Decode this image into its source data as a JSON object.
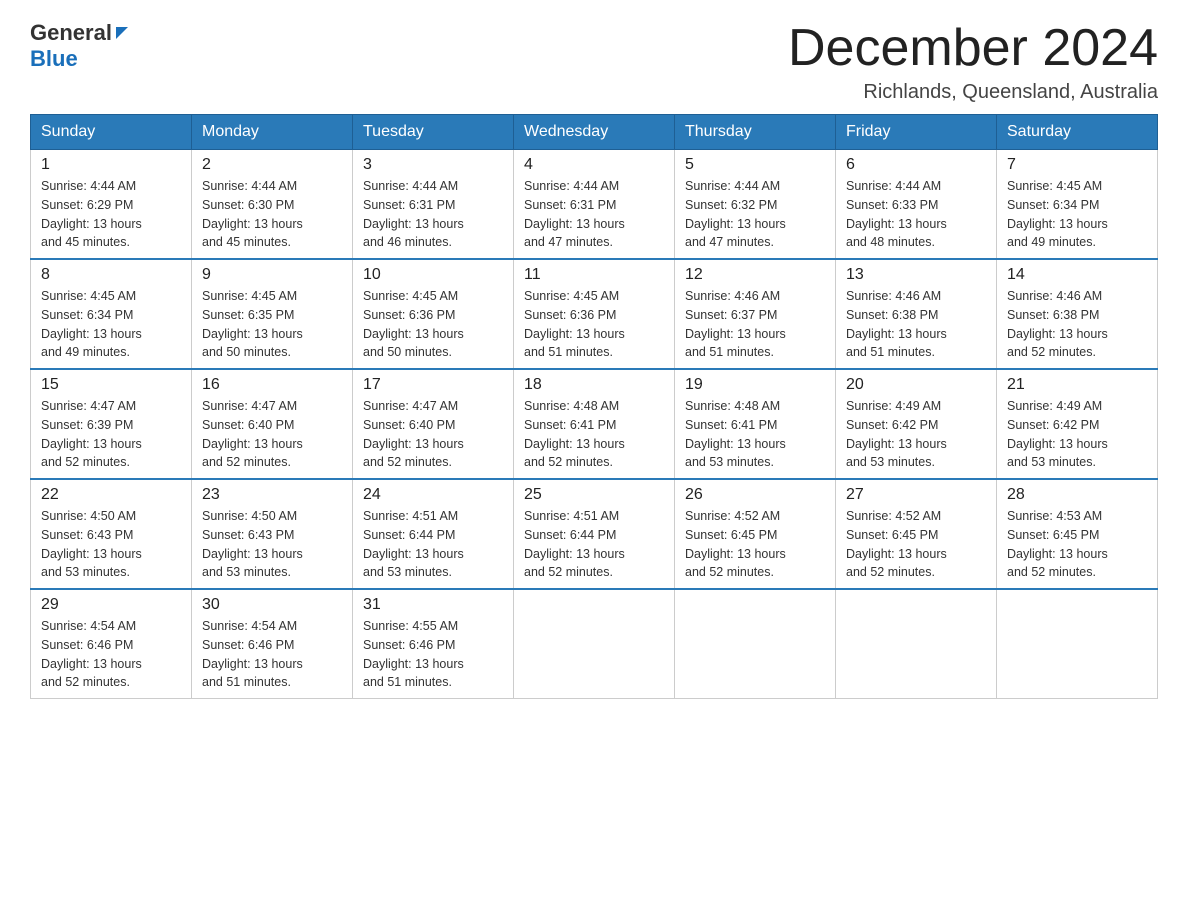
{
  "header": {
    "logo_general": "General",
    "logo_blue": "Blue",
    "month_title": "December 2024",
    "location": "Richlands, Queensland, Australia"
  },
  "weekdays": [
    "Sunday",
    "Monday",
    "Tuesday",
    "Wednesday",
    "Thursday",
    "Friday",
    "Saturday"
  ],
  "weeks": [
    [
      {
        "day": "1",
        "sunrise": "4:44 AM",
        "sunset": "6:29 PM",
        "daylight": "13 hours and 45 minutes."
      },
      {
        "day": "2",
        "sunrise": "4:44 AM",
        "sunset": "6:30 PM",
        "daylight": "13 hours and 45 minutes."
      },
      {
        "day": "3",
        "sunrise": "4:44 AM",
        "sunset": "6:31 PM",
        "daylight": "13 hours and 46 minutes."
      },
      {
        "day": "4",
        "sunrise": "4:44 AM",
        "sunset": "6:31 PM",
        "daylight": "13 hours and 47 minutes."
      },
      {
        "day": "5",
        "sunrise": "4:44 AM",
        "sunset": "6:32 PM",
        "daylight": "13 hours and 47 minutes."
      },
      {
        "day": "6",
        "sunrise": "4:44 AM",
        "sunset": "6:33 PM",
        "daylight": "13 hours and 48 minutes."
      },
      {
        "day": "7",
        "sunrise": "4:45 AM",
        "sunset": "6:34 PM",
        "daylight": "13 hours and 49 minutes."
      }
    ],
    [
      {
        "day": "8",
        "sunrise": "4:45 AM",
        "sunset": "6:34 PM",
        "daylight": "13 hours and 49 minutes."
      },
      {
        "day": "9",
        "sunrise": "4:45 AM",
        "sunset": "6:35 PM",
        "daylight": "13 hours and 50 minutes."
      },
      {
        "day": "10",
        "sunrise": "4:45 AM",
        "sunset": "6:36 PM",
        "daylight": "13 hours and 50 minutes."
      },
      {
        "day": "11",
        "sunrise": "4:45 AM",
        "sunset": "6:36 PM",
        "daylight": "13 hours and 51 minutes."
      },
      {
        "day": "12",
        "sunrise": "4:46 AM",
        "sunset": "6:37 PM",
        "daylight": "13 hours and 51 minutes."
      },
      {
        "day": "13",
        "sunrise": "4:46 AM",
        "sunset": "6:38 PM",
        "daylight": "13 hours and 51 minutes."
      },
      {
        "day": "14",
        "sunrise": "4:46 AM",
        "sunset": "6:38 PM",
        "daylight": "13 hours and 52 minutes."
      }
    ],
    [
      {
        "day": "15",
        "sunrise": "4:47 AM",
        "sunset": "6:39 PM",
        "daylight": "13 hours and 52 minutes."
      },
      {
        "day": "16",
        "sunrise": "4:47 AM",
        "sunset": "6:40 PM",
        "daylight": "13 hours and 52 minutes."
      },
      {
        "day": "17",
        "sunrise": "4:47 AM",
        "sunset": "6:40 PM",
        "daylight": "13 hours and 52 minutes."
      },
      {
        "day": "18",
        "sunrise": "4:48 AM",
        "sunset": "6:41 PM",
        "daylight": "13 hours and 52 minutes."
      },
      {
        "day": "19",
        "sunrise": "4:48 AM",
        "sunset": "6:41 PM",
        "daylight": "13 hours and 53 minutes."
      },
      {
        "day": "20",
        "sunrise": "4:49 AM",
        "sunset": "6:42 PM",
        "daylight": "13 hours and 53 minutes."
      },
      {
        "day": "21",
        "sunrise": "4:49 AM",
        "sunset": "6:42 PM",
        "daylight": "13 hours and 53 minutes."
      }
    ],
    [
      {
        "day": "22",
        "sunrise": "4:50 AM",
        "sunset": "6:43 PM",
        "daylight": "13 hours and 53 minutes."
      },
      {
        "day": "23",
        "sunrise": "4:50 AM",
        "sunset": "6:43 PM",
        "daylight": "13 hours and 53 minutes."
      },
      {
        "day": "24",
        "sunrise": "4:51 AM",
        "sunset": "6:44 PM",
        "daylight": "13 hours and 53 minutes."
      },
      {
        "day": "25",
        "sunrise": "4:51 AM",
        "sunset": "6:44 PM",
        "daylight": "13 hours and 52 minutes."
      },
      {
        "day": "26",
        "sunrise": "4:52 AM",
        "sunset": "6:45 PM",
        "daylight": "13 hours and 52 minutes."
      },
      {
        "day": "27",
        "sunrise": "4:52 AM",
        "sunset": "6:45 PM",
        "daylight": "13 hours and 52 minutes."
      },
      {
        "day": "28",
        "sunrise": "4:53 AM",
        "sunset": "6:45 PM",
        "daylight": "13 hours and 52 minutes."
      }
    ],
    [
      {
        "day": "29",
        "sunrise": "4:54 AM",
        "sunset": "6:46 PM",
        "daylight": "13 hours and 52 minutes."
      },
      {
        "day": "30",
        "sunrise": "4:54 AM",
        "sunset": "6:46 PM",
        "daylight": "13 hours and 51 minutes."
      },
      {
        "day": "31",
        "sunrise": "4:55 AM",
        "sunset": "6:46 PM",
        "daylight": "13 hours and 51 minutes."
      },
      null,
      null,
      null,
      null
    ]
  ],
  "labels": {
    "sunrise": "Sunrise:",
    "sunset": "Sunset:",
    "daylight": "Daylight: 13 hours"
  }
}
